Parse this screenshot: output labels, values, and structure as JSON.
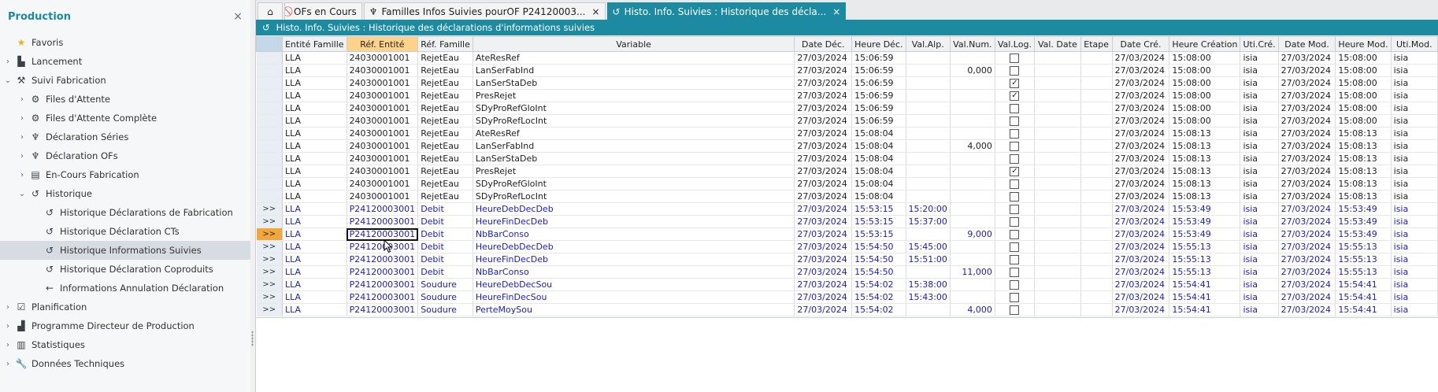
{
  "sidebar": {
    "title": "Production",
    "close": "×",
    "items": [
      {
        "label": "Favoris",
        "icon": "star-icon",
        "glyph": "★",
        "level": 0,
        "chevron": "",
        "active": false
      },
      {
        "label": "Lancement",
        "icon": "factory-icon",
        "glyph": "▙",
        "level": 0,
        "chevron": "›",
        "active": false
      },
      {
        "label": "Suivi Fabrication",
        "icon": "hammer-icon",
        "glyph": "⚒",
        "level": 0,
        "chevron": "⌄",
        "active": false
      },
      {
        "label": "Files d'Attente",
        "icon": "gears-icon",
        "glyph": "⚙",
        "level": 1,
        "chevron": "›",
        "active": false
      },
      {
        "label": "Files d'Attente Complète",
        "icon": "gears-icon",
        "glyph": "⚙",
        "level": 1,
        "chevron": "›",
        "active": false
      },
      {
        "label": "Déclaration Séries",
        "icon": "robot-arm-icon",
        "glyph": "♆",
        "level": 1,
        "chevron": "›",
        "active": false
      },
      {
        "label": "Déclaration OFs",
        "icon": "robot-arm-icon",
        "glyph": "♆",
        "level": 1,
        "chevron": "›",
        "active": false
      },
      {
        "label": "En-Cours Fabrication",
        "icon": "machine-icon",
        "glyph": "▤",
        "level": 1,
        "chevron": "›",
        "active": false
      },
      {
        "label": "Historique",
        "icon": "history-icon",
        "glyph": "↺",
        "level": 1,
        "chevron": "⌄",
        "active": false
      },
      {
        "label": "Historique Déclarations de Fabrication",
        "icon": "history-icon",
        "glyph": "↺",
        "level": 2,
        "chevron": "",
        "active": false
      },
      {
        "label": "Historique Déclaration CTs",
        "icon": "history-icon",
        "glyph": "↺",
        "level": 2,
        "chevron": "",
        "active": false
      },
      {
        "label": "Historique Informations Suivies",
        "icon": "history-icon",
        "glyph": "↺",
        "level": 2,
        "chevron": "",
        "active": true
      },
      {
        "label": "Historique Déclaration Coproduits",
        "icon": "history-icon",
        "glyph": "↺",
        "level": 2,
        "chevron": "",
        "active": false
      },
      {
        "label": "Informations Annulation Déclaration",
        "icon": "arrow-left-icon",
        "glyph": "←",
        "level": 2,
        "chevron": "",
        "active": false
      },
      {
        "label": "Planification",
        "icon": "calendar-check-icon",
        "glyph": "☑",
        "level": 0,
        "chevron": "›",
        "active": false
      },
      {
        "label": "Programme Directeur de Production",
        "icon": "factory-icon",
        "glyph": "▟",
        "level": 0,
        "chevron": "›",
        "active": false
      },
      {
        "label": "Statistiques",
        "icon": "chart-icon",
        "glyph": "▥",
        "level": 0,
        "chevron": "›",
        "active": false
      },
      {
        "label": "Données Techniques",
        "icon": "wrench-icon",
        "glyph": "🔧",
        "level": 0,
        "chevron": "›",
        "active": false
      }
    ]
  },
  "tabs": [
    {
      "label": "",
      "icon": "home-icon",
      "glyph": "⌂",
      "active": false,
      "home": true,
      "closable": false
    },
    {
      "label": "OFs en Cours",
      "icon": "no-entry-icon",
      "glyph": "⃠",
      "active": false,
      "home": false,
      "closable": false
    },
    {
      "label": "Familles Infos Suivies pourOF P24120003...",
      "icon": "robot-arm-icon",
      "glyph": "♆",
      "active": false,
      "home": false,
      "closable": true
    },
    {
      "label": "Histo. Info. Suivies : Historique des décla...",
      "icon": "history-icon",
      "glyph": "↺",
      "active": true,
      "home": false,
      "closable": true
    }
  ],
  "tab_close": "×",
  "subheader": {
    "icon": "history-icon",
    "glyph": "↺",
    "title": "Histo. Info. Suivies : Historique des déclarations d'informations suivies"
  },
  "table": {
    "columns": [
      {
        "label": "",
        "width": 34
      },
      {
        "label": "Entité Famille",
        "width": 73
      },
      {
        "label": "Réf. Entité",
        "width": 89
      },
      {
        "label": "Réf. Famille",
        "width": 66
      },
      {
        "label": "Variable",
        "width": 440
      },
      {
        "label": "Date Déc.",
        "width": 73
      },
      {
        "label": "Heure Déc.",
        "width": 65
      },
      {
        "label": "Val.Alp.",
        "width": 56
      },
      {
        "label": "Val.Num.",
        "width": 57
      },
      {
        "label": "Val.Log.",
        "width": 48
      },
      {
        "label": "Val. Date",
        "width": 59
      },
      {
        "label": "Etape",
        "width": 40
      },
      {
        "label": "Date Cré.",
        "width": 73
      },
      {
        "label": "Heure Création",
        "width": 80
      },
      {
        "label": "Uti.Cré.",
        "width": 48
      },
      {
        "label": "Date Mod.",
        "width": 73
      },
      {
        "label": "Heure Mod.",
        "width": 67
      },
      {
        "label": "Uti.Mod.",
        "width": 60
      }
    ],
    "rows": [
      {
        "sel": "",
        "c": [
          "LLA",
          "24030001001",
          "RejetEau",
          "AteResRef",
          "27/03/2024",
          "15:06:59",
          "",
          "",
          false,
          "",
          "",
          "27/03/2024",
          "15:08:00",
          "isia",
          "27/03/2024",
          "15:08:00",
          "isia"
        ],
        "blue": false
      },
      {
        "sel": "",
        "c": [
          "LLA",
          "24030001001",
          "RejetEau",
          "LanSerFabInd",
          "27/03/2024",
          "15:06:59",
          "",
          "0,000",
          false,
          "",
          "",
          "27/03/2024",
          "15:08:00",
          "isia",
          "27/03/2024",
          "15:08:00",
          "isia"
        ],
        "blue": false
      },
      {
        "sel": "",
        "c": [
          "LLA",
          "24030001001",
          "RejetEau",
          "LanSerStaDeb",
          "27/03/2024",
          "15:06:59",
          "",
          "",
          true,
          "",
          "",
          "27/03/2024",
          "15:08:00",
          "isia",
          "27/03/2024",
          "15:08:00",
          "isia"
        ],
        "blue": false
      },
      {
        "sel": "",
        "c": [
          "LLA",
          "24030001001",
          "RejetEau",
          "PresRejet",
          "27/03/2024",
          "15:06:59",
          "",
          "",
          true,
          "",
          "",
          "27/03/2024",
          "15:08:00",
          "isia",
          "27/03/2024",
          "15:08:00",
          "isia"
        ],
        "blue": false
      },
      {
        "sel": "",
        "c": [
          "LLA",
          "24030001001",
          "RejetEau",
          "SDyProRefGloInt",
          "27/03/2024",
          "15:06:59",
          "",
          "",
          false,
          "",
          "",
          "27/03/2024",
          "15:08:00",
          "isia",
          "27/03/2024",
          "15:08:00",
          "isia"
        ],
        "blue": false
      },
      {
        "sel": "",
        "c": [
          "LLA",
          "24030001001",
          "RejetEau",
          "SDyProRefLocInt",
          "27/03/2024",
          "15:06:59",
          "",
          "",
          false,
          "",
          "",
          "27/03/2024",
          "15:08:00",
          "isia",
          "27/03/2024",
          "15:08:00",
          "isia"
        ],
        "blue": false
      },
      {
        "sel": "",
        "c": [
          "LLA",
          "24030001001",
          "RejetEau",
          "AteResRef",
          "27/03/2024",
          "15:08:04",
          "",
          "",
          false,
          "",
          "",
          "27/03/2024",
          "15:08:13",
          "isia",
          "27/03/2024",
          "15:08:13",
          "isia"
        ],
        "blue": false
      },
      {
        "sel": "",
        "c": [
          "LLA",
          "24030001001",
          "RejetEau",
          "LanSerFabInd",
          "27/03/2024",
          "15:08:04",
          "",
          "4,000",
          false,
          "",
          "",
          "27/03/2024",
          "15:08:13",
          "isia",
          "27/03/2024",
          "15:08:13",
          "isia"
        ],
        "blue": false
      },
      {
        "sel": "",
        "c": [
          "LLA",
          "24030001001",
          "RejetEau",
          "LanSerStaDeb",
          "27/03/2024",
          "15:08:04",
          "",
          "",
          false,
          "",
          "",
          "27/03/2024",
          "15:08:13",
          "isia",
          "27/03/2024",
          "15:08:13",
          "isia"
        ],
        "blue": false
      },
      {
        "sel": "",
        "c": [
          "LLA",
          "24030001001",
          "RejetEau",
          "PresRejet",
          "27/03/2024",
          "15:08:04",
          "",
          "",
          true,
          "",
          "",
          "27/03/2024",
          "15:08:13",
          "isia",
          "27/03/2024",
          "15:08:13",
          "isia"
        ],
        "blue": false
      },
      {
        "sel": "",
        "c": [
          "LLA",
          "24030001001",
          "RejetEau",
          "SDyProRefGloInt",
          "27/03/2024",
          "15:08:04",
          "",
          "",
          false,
          "",
          "",
          "27/03/2024",
          "15:08:13",
          "isia",
          "27/03/2024",
          "15:08:13",
          "isia"
        ],
        "blue": false
      },
      {
        "sel": "",
        "c": [
          "LLA",
          "24030001001",
          "RejetEau",
          "SDyProRefLocInt",
          "27/03/2024",
          "15:08:04",
          "",
          "",
          false,
          "",
          "",
          "27/03/2024",
          "15:08:13",
          "isia",
          "27/03/2024",
          "15:08:13",
          "isia"
        ],
        "blue": false
      },
      {
        "sel": ">>",
        "c": [
          "LLA",
          "P24120003001",
          "Debit",
          "HeureDebDecDeb",
          "27/03/2024",
          "15:53:15",
          "15:20:00",
          "",
          false,
          "",
          "",
          "27/03/2024",
          "15:53:49",
          "isia",
          "27/03/2024",
          "15:53:49",
          "isia"
        ],
        "blue": true
      },
      {
        "sel": ">>",
        "c": [
          "LLA",
          "P24120003001",
          "Debit",
          "HeureFinDecDeb",
          "27/03/2024",
          "15:53:15",
          "15:37:00",
          "",
          false,
          "",
          "",
          "27/03/2024",
          "15:53:49",
          "isia",
          "27/03/2024",
          "15:53:49",
          "isia"
        ],
        "blue": true
      },
      {
        "sel": ">>",
        "c": [
          "LLA",
          "P24120003001",
          "Debit",
          "NbBarConso",
          "27/03/2024",
          "15:53:15",
          "",
          "9,000",
          false,
          "",
          "",
          "27/03/2024",
          "15:53:49",
          "isia",
          "27/03/2024",
          "15:53:49",
          "isia"
        ],
        "blue": true,
        "current": true
      },
      {
        "sel": ">>",
        "c": [
          "LLA",
          "P24120003001",
          "Debit",
          "HeureDebDecDeb",
          "27/03/2024",
          "15:54:50",
          "15:45:00",
          "",
          false,
          "",
          "",
          "27/03/2024",
          "15:55:13",
          "isia",
          "27/03/2024",
          "15:55:13",
          "isia"
        ],
        "blue": true
      },
      {
        "sel": ">>",
        "c": [
          "LLA",
          "P24120003001",
          "Debit",
          "HeureFinDecDeb",
          "27/03/2024",
          "15:54:50",
          "15:51:00",
          "",
          false,
          "",
          "",
          "27/03/2024",
          "15:55:13",
          "isia",
          "27/03/2024",
          "15:55:13",
          "isia"
        ],
        "blue": true
      },
      {
        "sel": ">>",
        "c": [
          "LLA",
          "P24120003001",
          "Debit",
          "NbBarConso",
          "27/03/2024",
          "15:54:50",
          "",
          "11,000",
          false,
          "",
          "",
          "27/03/2024",
          "15:55:13",
          "isia",
          "27/03/2024",
          "15:55:13",
          "isia"
        ],
        "blue": true
      },
      {
        "sel": ">>",
        "c": [
          "LLA",
          "P24120003001",
          "Soudure",
          "HeureDebDecSou",
          "27/03/2024",
          "15:54:02",
          "15:38:00",
          "",
          false,
          "",
          "",
          "27/03/2024",
          "15:54:41",
          "isia",
          "27/03/2024",
          "15:54:41",
          "isia"
        ],
        "blue": true
      },
      {
        "sel": ">>",
        "c": [
          "LLA",
          "P24120003001",
          "Soudure",
          "HeureFinDecSou",
          "27/03/2024",
          "15:54:02",
          "15:43:00",
          "",
          false,
          "",
          "",
          "27/03/2024",
          "15:54:41",
          "isia",
          "27/03/2024",
          "15:54:41",
          "isia"
        ],
        "blue": true
      },
      {
        "sel": ">>",
        "c": [
          "LLA",
          "P24120003001",
          "Soudure",
          "PerteMoySou",
          "27/03/2024",
          "15:54:02",
          "",
          "4,000",
          false,
          "",
          "",
          "27/03/2024",
          "15:54:41",
          "isia",
          "27/03/2024",
          "15:54:41",
          "isia"
        ],
        "blue": true
      }
    ]
  },
  "colors": {
    "accent": "#1c8aa0",
    "current_row_marker": "#f3a73a",
    "sorted_header": "#ffd28a",
    "link_text": "#1a1ad6"
  }
}
